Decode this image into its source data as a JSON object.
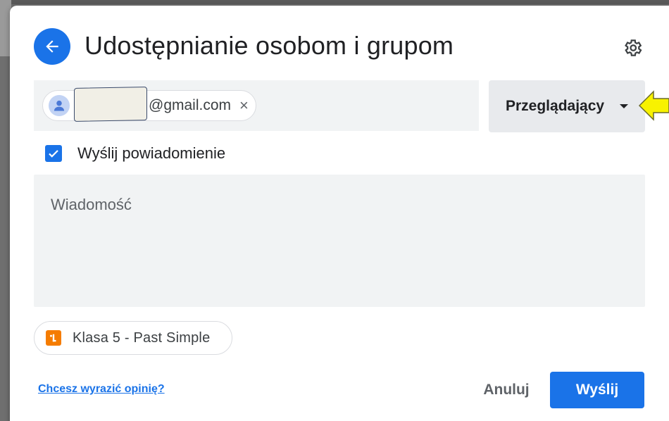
{
  "dialog": {
    "title": "Udostępnianie osobom i grupom"
  },
  "recipient": {
    "email_suffix": "@gmail.com",
    "remove_symbol": "×"
  },
  "role_selector": {
    "value": "Przeglądający"
  },
  "notify": {
    "checked": true,
    "label": "Wyślij powiadomienie"
  },
  "message": {
    "placeholder": "Wiadomość"
  },
  "attachment": {
    "label": "Klasa 5 - Past Simple",
    "icon": "google-forms-icon"
  },
  "footer": {
    "feedback_link": "Chcesz wyrazić opinię?",
    "cancel_label": "Anuluj",
    "send_label": "Wyślij"
  },
  "colors": {
    "accent": "#1a73e8",
    "field_bg": "#f1f3f4",
    "role_bg": "#e8eaed",
    "file_icon": "#f57c00",
    "annotation_arrow": "#f8f200"
  }
}
